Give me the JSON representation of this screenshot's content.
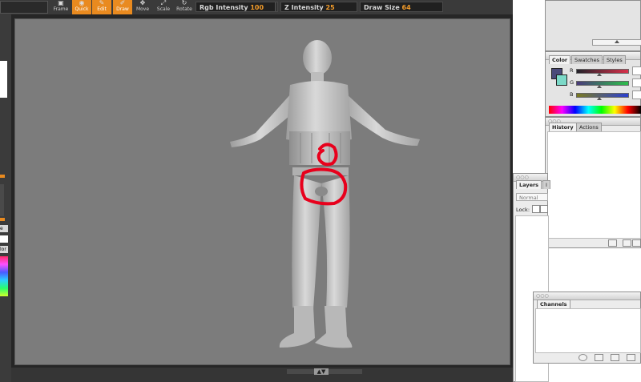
{
  "toolbar": {
    "tools": [
      {
        "label": "Frame",
        "active": false
      },
      {
        "label": "Quick",
        "active": true
      },
      {
        "label": "Edit",
        "active": true
      },
      {
        "label": "Draw",
        "active": true
      },
      {
        "label": "Move",
        "active": false
      },
      {
        "label": "Scale",
        "active": false
      },
      {
        "label": "Rotate",
        "active": false
      }
    ],
    "rgb_intensity": {
      "label": "Rgb Intensity",
      "value": "100"
    },
    "z_intensity": {
      "label": "Z Intensity",
      "value": "25"
    },
    "draw_size": {
      "label": "Draw Size",
      "value": "64"
    }
  },
  "left_panel": {
    "labels": [
      "e",
      "lor"
    ]
  },
  "color_palette": {
    "tabs": [
      "Color",
      "Swatches",
      "Styles"
    ],
    "channels": [
      {
        "label": "R",
        "color": "#d9304a"
      },
      {
        "label": "G",
        "color": "#2cbd4a"
      },
      {
        "label": "B",
        "color": "#2a3fd0"
      }
    ],
    "fg_color": "#4a4a7a",
    "bg_color": "#7cd9c8"
  },
  "history_palette": {
    "tabs": [
      "History",
      "Actions"
    ]
  },
  "layers_palette": {
    "tabs": [
      "Layers",
      "I"
    ],
    "blend_mode": "Normal",
    "lock_label": "Lock:"
  },
  "channels_palette": {
    "tabs": [
      "Channels"
    ]
  },
  "accent_colors": {
    "active_tool": "#e98a1f",
    "slider_value": "#f39c2a",
    "annotation": "#e8001c"
  }
}
